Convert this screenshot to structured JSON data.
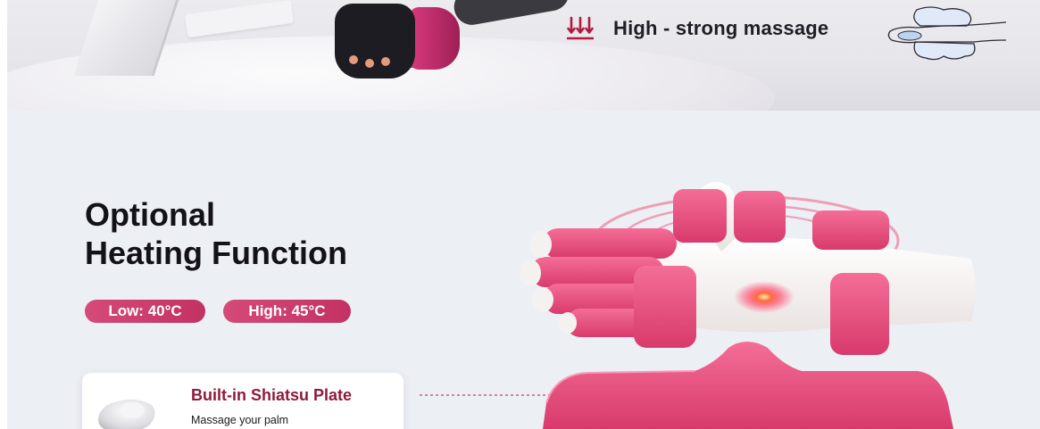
{
  "banner": {
    "mode_label": "High - strong massage"
  },
  "heating": {
    "title_line1": "Optional",
    "title_line2": "Heating Function",
    "low_label": "Low: 40°C",
    "high_label": "High: 45°C"
  },
  "feature_card": {
    "title": "Built-in Shiatsu Plate",
    "subtitle": "Massage your palm"
  },
  "colors": {
    "accent": "#c8386b",
    "accent_dark": "#8f1a3d",
    "background": "#eceff4"
  }
}
